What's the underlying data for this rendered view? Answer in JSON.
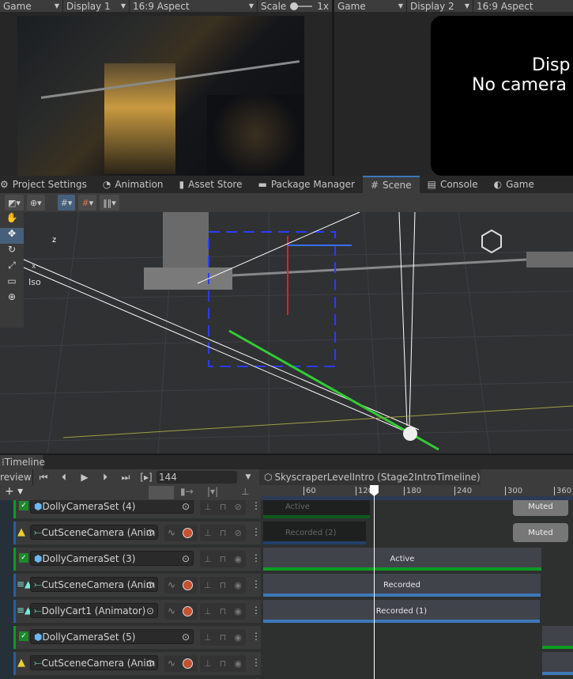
{
  "game_left": {
    "view": "Game",
    "display": "Display 1",
    "aspect": "16:9 Aspect",
    "scale_label": "Scale",
    "scale_value": "1x"
  },
  "game_right": {
    "view": "Game",
    "display": "Display 2",
    "aspect": "16:9 Aspect",
    "message_line1": "Disp",
    "message_line2": "No camera"
  },
  "tabs": [
    {
      "label": "Project Settings",
      "icon": "gear-icon"
    },
    {
      "label": "Animation",
      "icon": "clock-icon"
    },
    {
      "label": "Asset Store",
      "icon": "bag-icon"
    },
    {
      "label": "Package Manager",
      "icon": "package-icon"
    },
    {
      "label": "Scene",
      "icon": "grid-icon",
      "active": true
    },
    {
      "label": "Console",
      "icon": "console-icon"
    },
    {
      "label": "Game",
      "icon": "gamepad-icon"
    }
  ],
  "scene": {
    "iso_label": "Iso",
    "axis_z": "z",
    "axis_x": "x"
  },
  "timeline": {
    "tab": "Timeline",
    "preview": "review",
    "frame": "144",
    "asset": "SkyscraperLevelIntro (Stage2IntroTimeline)",
    "ruler": [
      "60",
      "120",
      "180",
      "240",
      "300",
      "360"
    ],
    "playhead_frame": 144,
    "tracks": [
      {
        "name": "DollyCameraSet (4)",
        "type": "group",
        "clip": "Active",
        "muted": "Muted"
      },
      {
        "name": "CutSceneCamera (Anim",
        "type": "anim-warn",
        "clip": "Recorded (2)",
        "muted": "Muted"
      },
      {
        "name": "DollyCameraSet (3)",
        "type": "group",
        "clip": "Active"
      },
      {
        "name": "CutSceneCamera (Anim",
        "type": "anim",
        "clip": "Recorded"
      },
      {
        "name": "DollyCart1 (Animator)",
        "type": "anim",
        "clip": "Recorded (1)"
      },
      {
        "name": "DollyCameraSet (5)",
        "type": "group",
        "clip": ""
      },
      {
        "name": "CutSceneCamera (Anim",
        "type": "anim-warn",
        "clip": ""
      }
    ]
  },
  "colors": {
    "accent": "#3a79bb",
    "active_green": "#0c9c24",
    "recorded_blue": "#3d78b8",
    "record_red": "#c4512f"
  }
}
